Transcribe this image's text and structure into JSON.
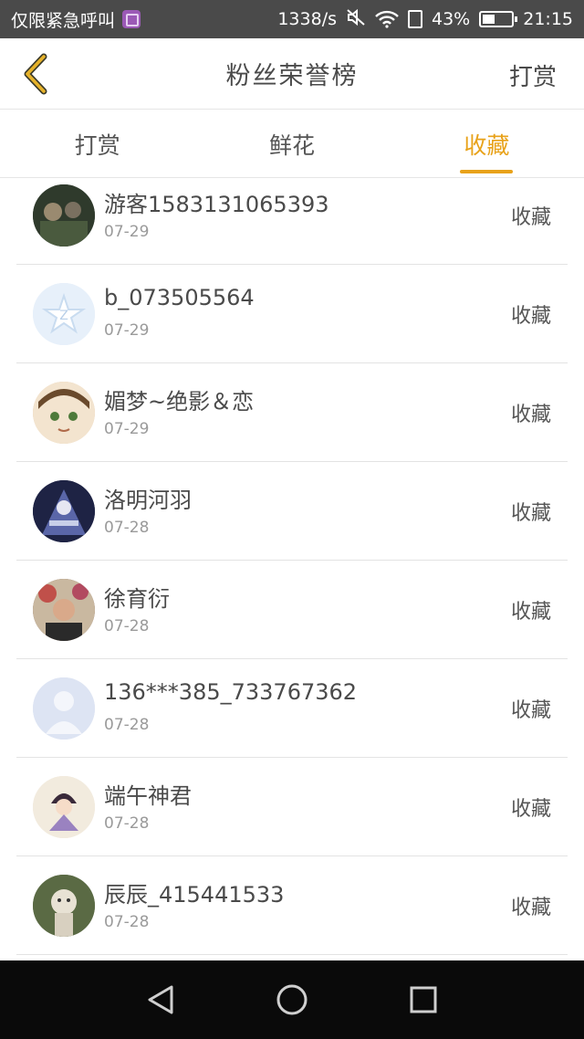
{
  "status_bar": {
    "left_text": "仅限紧急呼叫",
    "speed": "1338/s",
    "battery": "43%",
    "time": "21:15"
  },
  "header": {
    "title": "粉丝荣誉榜",
    "action": "打赏"
  },
  "tabs": [
    {
      "label": "打赏",
      "active": false
    },
    {
      "label": "鲜花",
      "active": false
    },
    {
      "label": "收藏",
      "active": true
    }
  ],
  "rows": [
    {
      "name": "游客1583131065393",
      "date": "07-29",
      "action": "收藏",
      "avatar_color": "#3b4a38"
    },
    {
      "name": "b_073505564",
      "date": "07-29",
      "action": "收藏",
      "avatar_color": "#e4eef8"
    },
    {
      "name": "媚梦~绝影＆恋",
      "date": "07-29",
      "action": "收藏",
      "avatar_color": "#e8c9a6"
    },
    {
      "name": "洛明河羽",
      "date": "07-28",
      "action": "收藏",
      "avatar_color": "#2a2f55"
    },
    {
      "name": "徐育衍",
      "date": "07-28",
      "action": "收藏",
      "avatar_color": "#7a5a4a"
    },
    {
      "name": "136***385_733767362",
      "date": "07-28",
      "action": "收藏",
      "avatar_color": "#dfe5f2"
    },
    {
      "name": "端午神君",
      "date": "07-28",
      "action": "收藏",
      "avatar_color": "#efe6d8"
    },
    {
      "name": "辰辰_415441533",
      "date": "07-28",
      "action": "收藏",
      "avatar_color": "#6b7a52"
    }
  ],
  "colors": {
    "accent": "#e8a21a",
    "back_icon": "#d39a1a"
  }
}
